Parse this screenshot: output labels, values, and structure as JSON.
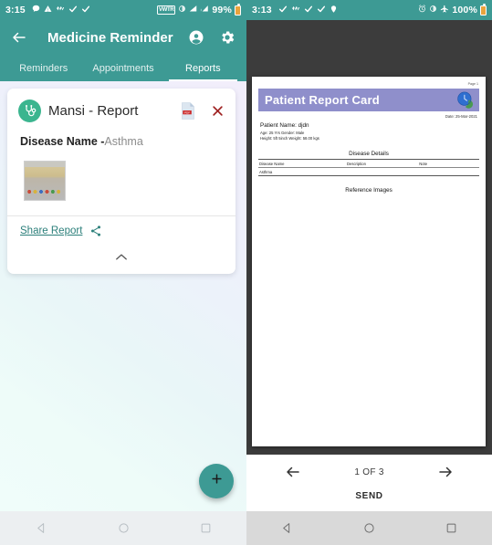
{
  "left_phone": {
    "status_bar": {
      "time": "3:15",
      "left_icons": [
        "message-icon",
        "warning-triangle-icon",
        "wifi-calling-icon",
        "check-icon",
        "check-icon"
      ],
      "right_icons": [
        "vwtr-badge",
        "brightness-icon",
        "signal-bars-icon",
        "signal-roaming-icon"
      ],
      "vwtr_label": "VWTR",
      "battery_percent": "99%",
      "bar_color": "#3d9a94"
    },
    "app_bar": {
      "back_icon": "back-arrow-icon",
      "title": "Medicine Reminder",
      "account_icon": "account-circle-icon",
      "settings_icon": "gear-icon"
    },
    "tabs": [
      {
        "label": "Reminders",
        "active": false
      },
      {
        "label": "Appointments",
        "active": false
      },
      {
        "label": "Reports",
        "active": true
      }
    ],
    "report_card": {
      "avatar_icon": "stethoscope-icon",
      "title": "Mansi - Report",
      "pdf_icon": "pdf-file-icon",
      "close_icon": "close-icon",
      "field_label": "Disease Name",
      "field_separator": " -",
      "field_value": "Asthma",
      "thumbnail_alt": "report-image-thumbnail",
      "share_label": "Share Report",
      "share_icon": "share-icon",
      "collapse_icon": "chevron-up-icon"
    },
    "fab": {
      "icon": "plus-icon",
      "color": "#3d9a94"
    },
    "nav_bar": {
      "back_icon": "nav-back-triangle-icon",
      "home_icon": "nav-home-circle-icon",
      "recents_icon": "nav-recents-square-icon"
    }
  },
  "right_phone": {
    "status_bar": {
      "time": "3:13",
      "left_icons": [
        "check-icon",
        "wifi-calling-icon",
        "check-icon",
        "check-icon",
        "location-pin-icon"
      ],
      "right_icons": [
        "alarm-icon",
        "brightness-icon",
        "airplane-icon"
      ],
      "battery_percent": "100%",
      "bar_color": "#3d9a94"
    },
    "document": {
      "page_number_label": "Page 1",
      "banner_title": "Patient Report Card",
      "banner_color": "#8f8fcb",
      "logo_icon": "clinic-logo-icon",
      "date": "Date: 25-Mar-2021",
      "patient_name": "Patient Name: djdn",
      "age_gender": "Age: 25 Yrs  Gender: Male",
      "height_weight": "Height: 5ft 5inch   Weight: 58.00 kgs",
      "disease_section_title": "Disease Details",
      "table_headers": [
        "Disease Name",
        "Description",
        "Note"
      ],
      "table_rows": [
        [
          "Asthma",
          "",
          ""
        ]
      ],
      "reference_section_title": "Reference Images"
    },
    "controls": {
      "prev_icon": "arrow-left-icon",
      "page_counter": "1 OF 3",
      "next_icon": "arrow-right-icon",
      "send_label": "SEND"
    },
    "nav_bar": {
      "back_icon": "nav-back-triangle-icon",
      "home_icon": "nav-home-circle-icon",
      "recents_icon": "nav-recents-square-icon"
    }
  }
}
